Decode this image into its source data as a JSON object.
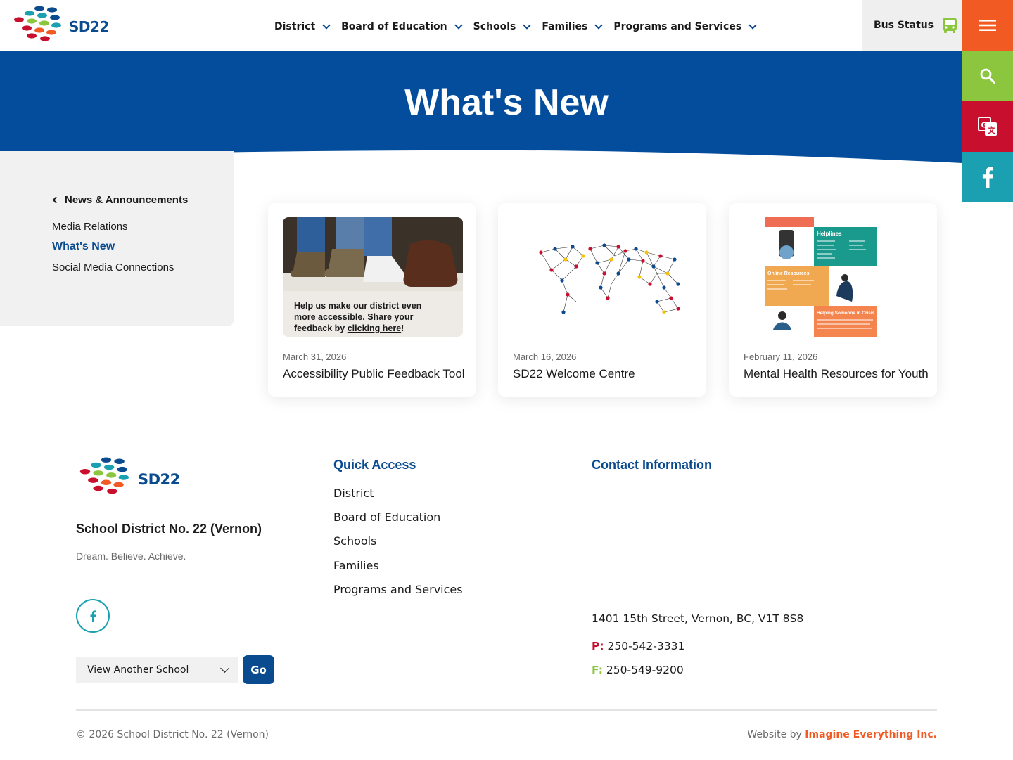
{
  "brand": {
    "logo_text": "SD22",
    "colors": {
      "primary": "#0a4a8f",
      "orange": "#f15a22",
      "green": "#8cc63f",
      "red": "#c8102e",
      "teal": "#1aa0b0"
    }
  },
  "header": {
    "nav": [
      {
        "label": "District"
      },
      {
        "label": "Board of Education"
      },
      {
        "label": "Schools"
      },
      {
        "label": "Families"
      },
      {
        "label": "Programs and Services"
      }
    ],
    "bus_status": {
      "label": "Bus Status",
      "icon": "bus-icon"
    },
    "side_buttons": [
      {
        "icon": "menu-icon"
      },
      {
        "icon": "search-icon"
      },
      {
        "icon": "translate-icon"
      },
      {
        "icon": "facebook-icon"
      }
    ]
  },
  "hero": {
    "title": "What's New"
  },
  "sidebar": {
    "parent": "News & Announcements",
    "items": [
      {
        "label": "Media Relations",
        "active": false
      },
      {
        "label": "What's New",
        "active": true
      },
      {
        "label": "Social Media Connections",
        "active": false
      }
    ]
  },
  "cards": [
    {
      "date": "March 31, 2026",
      "title": "Accessibility Public Feedback Tool",
      "image_caption": {
        "pre": "Help us make our district even more accessible. Share your feedback by ",
        "link": "clicking here",
        "post": "!"
      }
    },
    {
      "date": "March 16, 2026",
      "title": "SD22 Welcome Centre"
    },
    {
      "date": "February 11, 2026",
      "title": "Mental Health Resources for Youth",
      "image_labels": {
        "helplines": "Helplines",
        "online": "Online Resources",
        "crisis": "Helping Someone in Crisis"
      }
    }
  ],
  "footer": {
    "org_name": "School District No. 22 (Vernon)",
    "tagline": "Dream. Believe. Achieve.",
    "school_select": {
      "selected": "View Another School"
    },
    "go_label": "Go",
    "quick_access": {
      "heading": "Quick Access",
      "links": [
        "District",
        "Board of Education",
        "Schools",
        "Families",
        "Programs and Services"
      ]
    },
    "contact": {
      "heading": "Contact Information",
      "address": "1401 15th Street, Vernon, BC, V1T 8S8",
      "phone_prefix": "P:",
      "phone": "250-542-3331",
      "fax_prefix": "F:",
      "fax": "250-549-9200"
    },
    "copyright": "© 2026 School District No. 22 (Vernon)",
    "credit_prefix": "Website by",
    "credit_link": "Imagine Everything Inc."
  }
}
